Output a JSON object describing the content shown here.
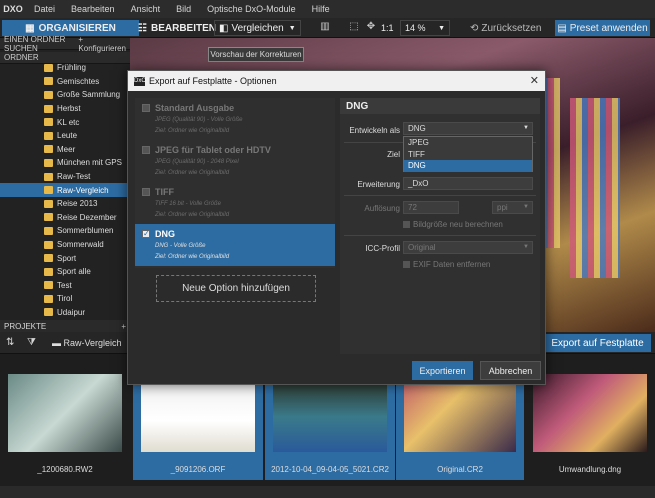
{
  "menu": {
    "items": [
      "Datei",
      "Bearbeiten",
      "Ansicht",
      "Bild",
      "Optische DxO-Module",
      "Hilfe"
    ],
    "logo": "DXO"
  },
  "toolbar": {
    "organize": "ORGANISIEREN",
    "edit": "BEARBEITEN",
    "compare": "Vergleichen",
    "ratio": "1:1",
    "zoom": "14 %",
    "reset": "Zurücksetzen",
    "preset": "Preset anwenden"
  },
  "tooltip": "Vorschau der Korrekturen",
  "leftpanel": {
    "search": "EINEN ORDNER SUCHEN",
    "configure": "+ Konfigurieren",
    "folder_header": "ORDNER",
    "folders": [
      "Frühling",
      "Gemischtes",
      "Große Sammlung",
      "Herbst",
      "KL etc",
      "Leute",
      "Meer",
      "München mit GPS",
      "Raw-Test",
      "Raw-Vergleich",
      "Reise 2013",
      "Reise Dezember",
      "Sommerblumen",
      "Sommerwald",
      "Sport",
      "Sport alle",
      "Test",
      "Tirol",
      "Udaipur"
    ],
    "selected": "Raw-Vergleich",
    "projects": "PROJEKTE",
    "projects_add": "+",
    "path": "Raw-Vergleich"
  },
  "export_button": "Export auf Festplatte",
  "filmstrip": [
    "_1200680.RW2",
    "_9091206.ORF",
    "2012-10-04_09-04-05_5021.CR2",
    "Original.CR2",
    "Umwandlung.dng"
  ],
  "dialog": {
    "title": "Export auf Festplatte - Optionen",
    "logo": "DxO",
    "close": "✕",
    "options": [
      {
        "name": "Standard Ausgabe",
        "desc1": "JPEG (Qualität 90)  -  Volle Größe",
        "desc2": "Ziel: Ordner wie Originalbild"
      },
      {
        "name": "JPEG für Tablet oder HDTV",
        "desc1": "JPEG (Qualität 90)  -  2048 Pixel",
        "desc2": "Ziel: Ordner wie Originalbild"
      },
      {
        "name": "TIFF",
        "desc1": "TIFF 16 bit  -  Volle Größe",
        "desc2": "Ziel: Ordner wie Originalbild"
      },
      {
        "name": "DNG",
        "desc1": "DNG  -  Volle Größe",
        "desc2": "Ziel: Ordner wie Originalbild"
      }
    ],
    "new_option": "Neue Option hinzufügen",
    "settings": {
      "header": "DNG",
      "develop_label": "Entwickeln als",
      "develop_value": "DNG",
      "dropdown": [
        "JPEG",
        "TIFF",
        "DNG"
      ],
      "target_label": "Ziel",
      "extension_label": "Erweiterung",
      "extension_value": "_DxO",
      "resolution_label": "Auflösung",
      "resolution_value": "72",
      "unit": "ppi",
      "recompute": "Bildgröße neu berechnen",
      "icc_label": "ICC-Profil",
      "icc_value": "Original",
      "exif": "EXIF Daten entfernen"
    },
    "export": "Exportieren",
    "cancel": "Abbrechen"
  }
}
